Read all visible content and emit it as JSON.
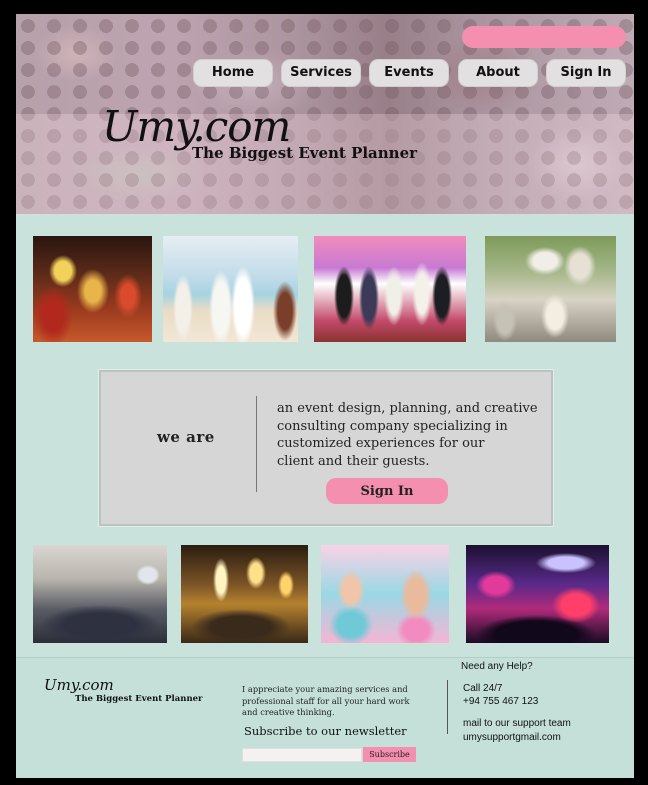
{
  "header": {
    "nav": [
      {
        "label": "Home"
      },
      {
        "label": "Services"
      },
      {
        "label": "Events"
      },
      {
        "label": "About"
      },
      {
        "label": "Sign In"
      }
    ],
    "logo": "Umy.com",
    "tagline": "The Biggest Event Planner"
  },
  "intro": {
    "heading": "we are",
    "lines": [
      "an event design, planning, and creative",
      " consulting company specializing in",
      " customized  experiences for our",
      "client and their guests."
    ],
    "button": "Sign In"
  },
  "footer": {
    "logo": "Umy.com",
    "tagline": "The Biggest Event Planner",
    "quote_lines": [
      "I appreciate your amazing services and",
      "professional staff for all your hard work",
      "and creative thinking."
    ],
    "newsletter": "Subscribe to our newsletter",
    "subscribe_button": "Subscribe",
    "help_title": "Need any Help?",
    "call_label": "Call 24/7",
    "phone": "+94 755 467 123",
    "mail_label": "mail to our support team",
    "email": "umysupportgmail.com"
  },
  "colors": {
    "background": "#c9e2dc",
    "accent_pink": "#f58fb0",
    "panel_grey": "#d6d6d6",
    "frame": "#000000"
  }
}
